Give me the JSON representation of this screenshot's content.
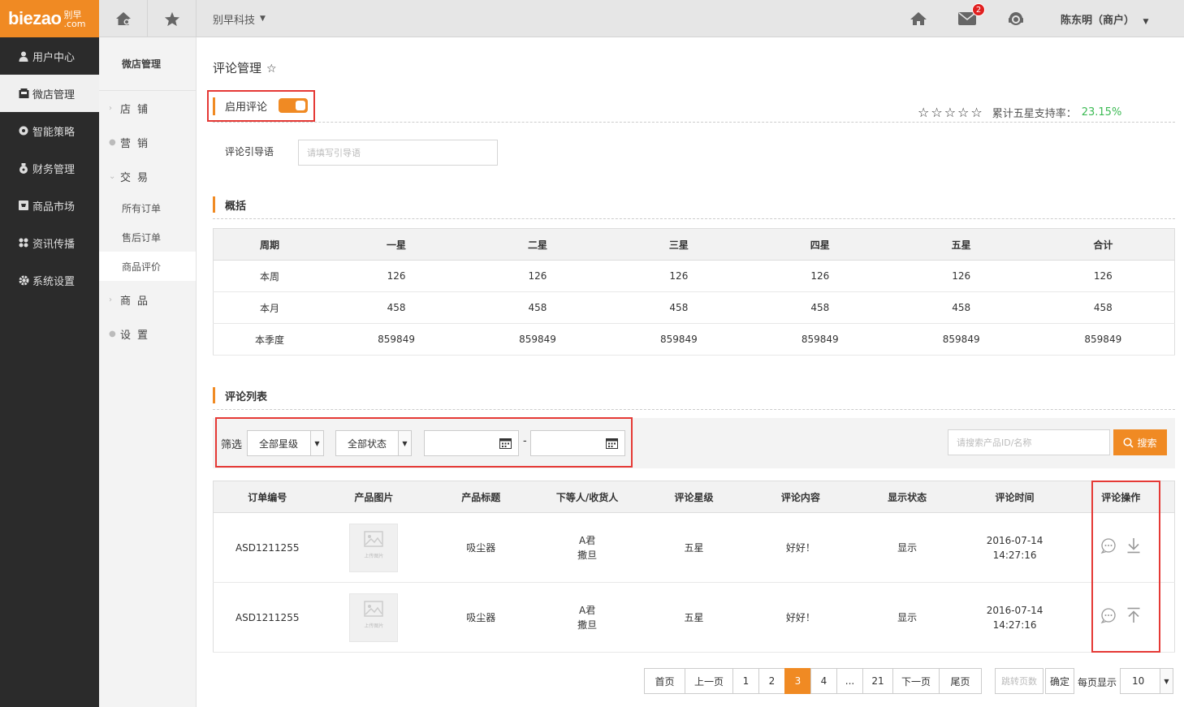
{
  "logo": {
    "main": "biezao",
    "cn": "别早",
    "dotcom": ".com"
  },
  "topbar": {
    "company": "别早科技",
    "user": "陈东明（商户）",
    "mail_badge": "2"
  },
  "sidebar": {
    "items": [
      {
        "label": "用户中心",
        "icon": "user-icon"
      },
      {
        "label": "微店管理",
        "icon": "shop-icon"
      },
      {
        "label": "智能策略",
        "icon": "strategy-icon"
      },
      {
        "label": "财务管理",
        "icon": "money-bag-icon"
      },
      {
        "label": "商品市场",
        "icon": "market-icon"
      },
      {
        "label": "资讯传播",
        "icon": "grid-icon"
      },
      {
        "label": "系统设置",
        "icon": "gear-icon"
      }
    ]
  },
  "subnav": {
    "title": "微店管理",
    "groups": {
      "store": "店铺",
      "marketing": "营销",
      "trade": "交易",
      "goods": "商品",
      "settings": "设置"
    },
    "subs": {
      "all_orders": "所有订单",
      "after_sale": "售后订单",
      "reviews": "商品评价"
    }
  },
  "page": {
    "title": "评论管理",
    "enable_label": "启用评论",
    "rating_stars": "☆☆☆☆☆",
    "rating_label": "累计五星支持率：",
    "rating_value": "23.15%",
    "guide_label": "评论引导语",
    "guide_placeholder": "请填写引导语"
  },
  "summary": {
    "heading": "概括",
    "headers": [
      "周期",
      "一星",
      "二星",
      "三星",
      "四星",
      "五星",
      "合计"
    ],
    "rows": [
      [
        "本周",
        "126",
        "126",
        "126",
        "126",
        "126",
        "126"
      ],
      [
        "本月",
        "458",
        "458",
        "458",
        "458",
        "458",
        "458"
      ],
      [
        "本季度",
        "859849",
        "859849",
        "859849",
        "859849",
        "859849",
        "859849"
      ]
    ]
  },
  "list": {
    "heading": "评论列表",
    "filter_label": "筛选",
    "star_select": "全部星级",
    "status_select": "全部状态",
    "date_sep": "-",
    "search_placeholder": "请搜索产品ID/名称",
    "search_button": "搜索",
    "headers": [
      "订单编号",
      "产品图片",
      "产品标题",
      "下等人/收货人",
      "评论星级",
      "评论内容",
      "显示状态",
      "评论时间",
      "评论操作"
    ],
    "thumb_text": "上传图片",
    "rows": [
      {
        "order": "ASD1211255",
        "title": "吸尘器",
        "buyer": "A君",
        "receiver": "撒旦",
        "stars": "五星",
        "content": "好好！",
        "status": "显示",
        "date": "2016-07-14",
        "time": "14:27:16",
        "op2": "download-icon"
      },
      {
        "order": "ASD1211255",
        "title": "吸尘器",
        "buyer": "A君",
        "receiver": "撒旦",
        "stars": "五星",
        "content": "好好！",
        "status": "显示",
        "date": "2016-07-14",
        "time": "14:27:16",
        "op2": "top-icon"
      }
    ]
  },
  "pager": {
    "first": "首页",
    "prev": "上一页",
    "p1": "1",
    "p2": "2",
    "p3": "3",
    "p4": "4",
    "ellipsis": "...",
    "p21": "21",
    "next": "下一页",
    "last": "尾页",
    "jump_placeholder": "跳转页数",
    "confirm": "确定",
    "per_page_label": "每页显示",
    "per_page": "10"
  },
  "colors": {
    "accent": "#f08a23",
    "sidebar": "#2b2b2b",
    "success": "#3cba54",
    "highlight": "#e53935"
  }
}
